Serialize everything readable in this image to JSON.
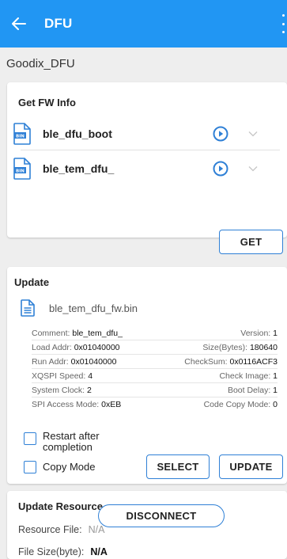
{
  "appbar": {
    "title": "DFU"
  },
  "device_name": "Goodix_DFU",
  "fw_info": {
    "title": "Get FW Info",
    "items": [
      {
        "label": "ble_dfu_boot"
      },
      {
        "label": "ble_tem_dfu_"
      }
    ],
    "get_label": "GET"
  },
  "update": {
    "title": "Update",
    "file_name": "ble_tem_dfu_fw.bin",
    "info": [
      {
        "left_label": "Comment:",
        "left_value": "ble_tem_dfu_",
        "right_label": "Version:",
        "right_value": "1"
      },
      {
        "left_label": "Load Addr:",
        "left_value": "0x01040000",
        "right_label": "Size(Bytes):",
        "right_value": "180640"
      },
      {
        "left_label": "Run Addr:",
        "left_value": "0x01040000",
        "right_label": "CheckSum:",
        "right_value": "0x0116ACF3"
      },
      {
        "left_label": "XQSPI Speed:",
        "left_value": "4",
        "right_label": "Check Image:",
        "right_value": "1"
      },
      {
        "left_label": "System Clock:",
        "left_value": "2",
        "right_label": "Boot Delay:",
        "right_value": "1"
      },
      {
        "left_label": "SPI Access Mode:",
        "left_value": "0xEB",
        "right_label": "Code Copy Mode:",
        "right_value": "0"
      }
    ],
    "restart_label_1": "Restart after",
    "restart_label_2": "completion",
    "copy_mode_label": "Copy Mode",
    "select_label": "SELECT",
    "update_label": "UPDATE"
  },
  "resource": {
    "title": "Update Resource",
    "file_label": "Resource File:",
    "file_value": "N/A",
    "size_label": "File Size(byte):",
    "size_value": "N/A"
  },
  "disconnect_label": "DISCONNECT",
  "colors": {
    "appbar": "#2196f3",
    "accent": "#2f80d6"
  }
}
